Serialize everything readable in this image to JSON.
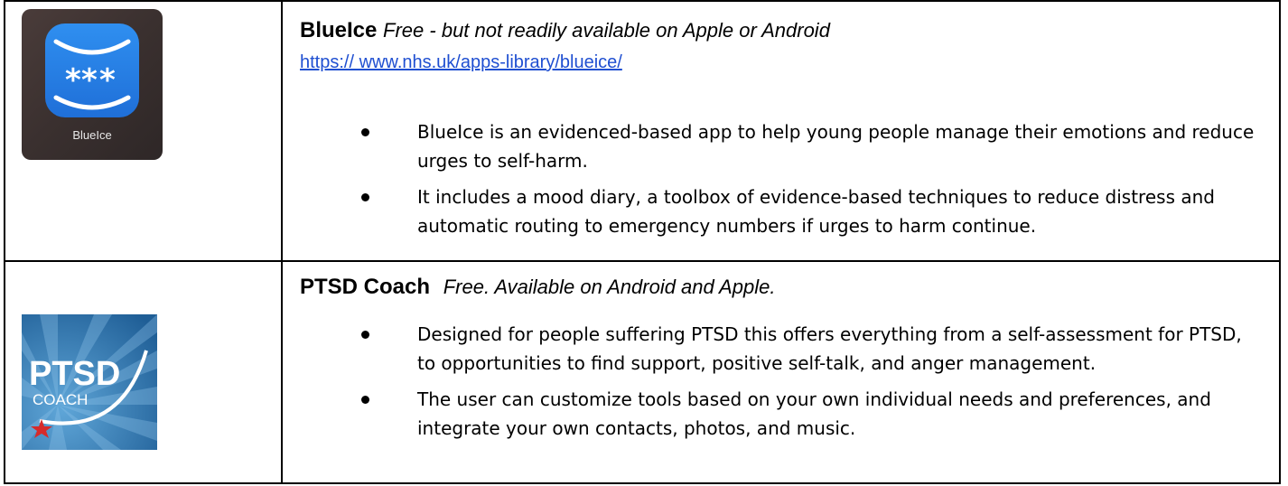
{
  "rows": [
    {
      "icon_name": "blueice-app-icon",
      "icon_label": "BlueIce",
      "title": "BlueIce",
      "subtitle": "Free - but not readily available on Apple or Android",
      "link": "https:// www.nhs.uk/apps-library/blueice/",
      "bullets": [
        "BlueIce is an evidenced-based app to help young people manage their emotions and reduce urges to self-harm.",
        "It includes a mood diary, a toolbox of evidence-based techniques to reduce distress and automatic routing to emergency numbers if urges to harm continue."
      ]
    },
    {
      "icon_name": "ptsd-coach-app-icon",
      "icon_label": "PTSD",
      "icon_sublabel": "COACH",
      "title": "PTSD Coach",
      "subtitle": "Free.  Available on Android and Apple.",
      "bullets": [
        "Designed for people suffering PTSD this offers everything from a self-assessment for PTSD, to opportunities to find support, positive self-talk, and anger management.",
        "The user can customize tools based on your own individual needs and preferences, and integrate your own contacts, photos, and music."
      ]
    }
  ],
  "colors": {
    "link": "#1f4fd1",
    "blueice_tile": "#2a84ec",
    "ptsd_bg": "#2a6fa8"
  }
}
